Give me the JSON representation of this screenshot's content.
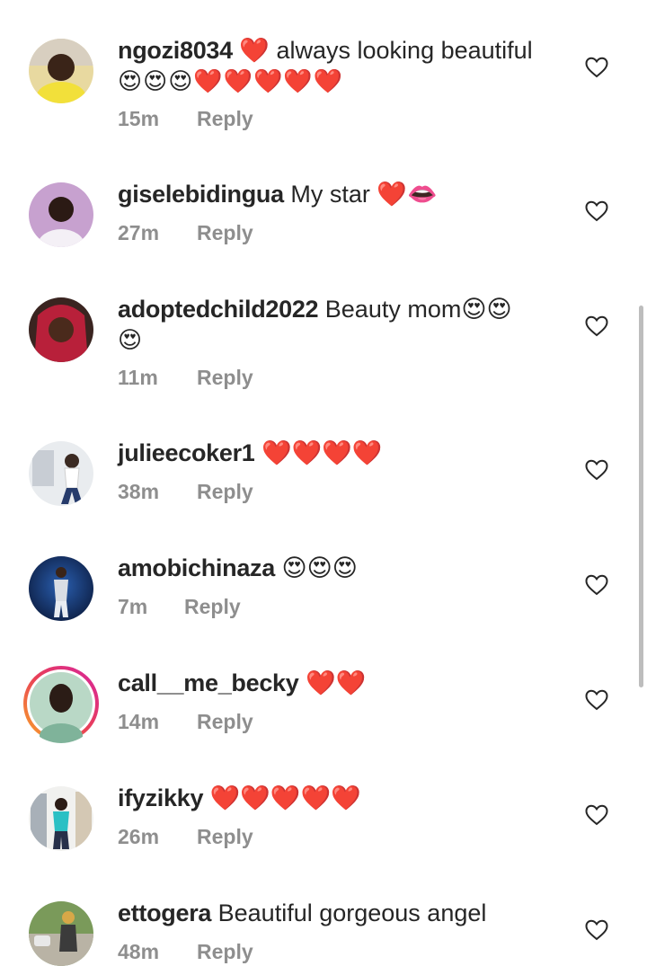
{
  "comments": [
    {
      "username": "ngozi8034",
      "text": "❤️ always looking beautiful",
      "emojis": "😍😍😍❤️❤️❤️❤️❤️",
      "time": "15m",
      "reply": "Reply"
    },
    {
      "username": "giselebidingua",
      "text": "My star ❤️👄",
      "time": "27m",
      "reply": "Reply"
    },
    {
      "username": "adoptedchild2022",
      "text": "Beauty mom😍😍",
      "emojis": "😍",
      "time": "11m",
      "reply": "Reply"
    },
    {
      "username": "julieecoker1",
      "text": "❤️❤️❤️❤️",
      "time": "38m",
      "reply": "Reply"
    },
    {
      "username": "amobichinaza",
      "text": "😍😍😍",
      "time": "7m",
      "reply": "Reply"
    },
    {
      "username": "call__me_becky",
      "text": "❤️❤️",
      "time": "14m",
      "reply": "Reply"
    },
    {
      "username": "ifyzikky",
      "text": "❤️❤️❤️❤️❤️",
      "time": "26m",
      "reply": "Reply"
    },
    {
      "username": "ettogera",
      "text": "Beautiful gorgeous angel",
      "time": "48m",
      "reply": "Reply"
    }
  ],
  "icons": {
    "like": "heart-outline-icon",
    "story_ring": "story-ring-icon"
  },
  "colors": {
    "text": "#262626",
    "meta": "#8e8e8e",
    "heart": "#ed1c24",
    "ring_start": "#f9a825",
    "ring_end": "#d6249f"
  }
}
